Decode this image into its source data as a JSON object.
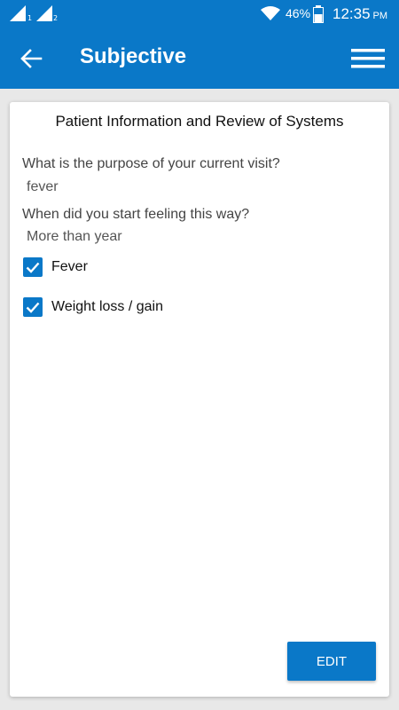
{
  "status_bar": {
    "sim1_label": "1",
    "sim2_label": "2",
    "battery_percent": "46%",
    "time": "12:35",
    "ampm": "PM",
    "icons": [
      "signal-icon",
      "signal-icon",
      "wifi-icon",
      "battery-icon"
    ]
  },
  "app_bar": {
    "title": "Subjective",
    "back_icon": "arrow-left-icon",
    "menu_icon": "hamburger-menu-icon"
  },
  "card": {
    "heading": "Patient Information and Review of Systems",
    "questions": [
      {
        "question": "What is the purpose of your current visit?",
        "answer": "fever"
      },
      {
        "question": "When did you start feeling this way?",
        "answer": "More than year"
      }
    ],
    "checkboxes": [
      {
        "label": "Fever",
        "checked": true
      },
      {
        "label": "Weight loss / gain",
        "checked": true
      }
    ],
    "edit_label": "EDIT"
  },
  "colors": {
    "primary": "#0a78c8",
    "background": "#e8e8e8",
    "card": "#ffffff"
  }
}
